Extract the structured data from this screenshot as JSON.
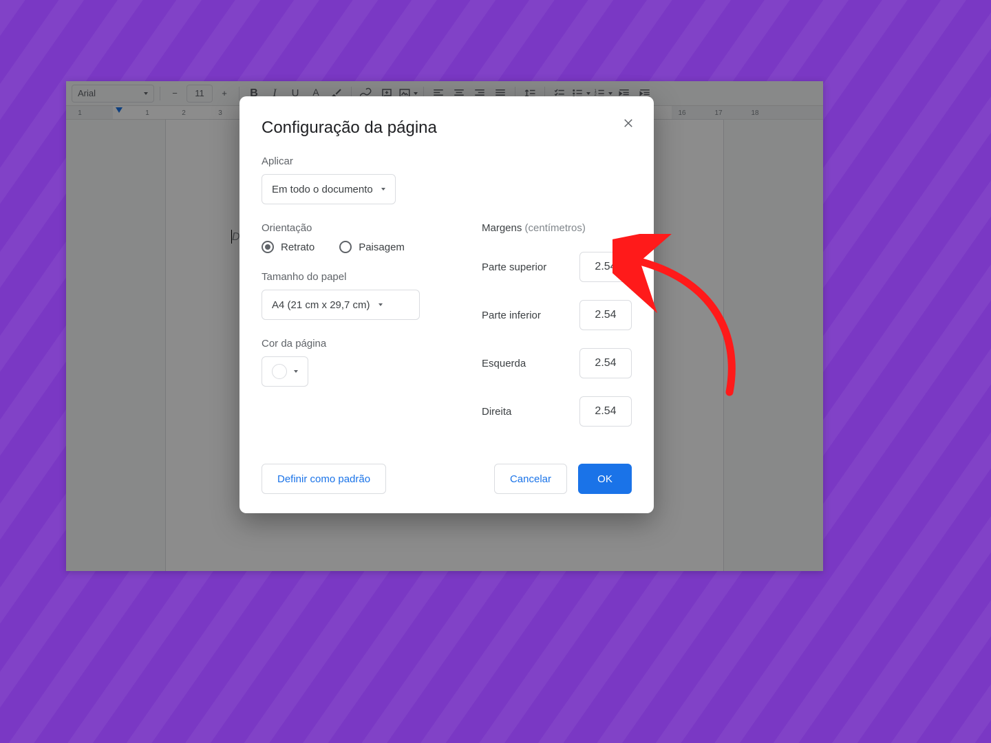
{
  "toolbar": {
    "font_name": "Arial",
    "font_size": "11"
  },
  "ruler": {
    "labels": [
      1,
      1,
      2,
      3,
      16,
      17,
      18
    ]
  },
  "document": {
    "placeholder": "Digite @ para inser"
  },
  "dialog": {
    "title": "Configuração da página",
    "apply_label": "Aplicar",
    "apply_value": "Em todo o documento",
    "orientation_label": "Orientação",
    "orientation_portrait": "Retrato",
    "orientation_landscape": "Paisagem",
    "orientation_selected": "portrait",
    "paper_label": "Tamanho do papel",
    "paper_value": "A4 (21 cm x 29,7 cm)",
    "page_color_label": "Cor da página",
    "margins_label": "Margens",
    "margins_unit": "(centímetros)",
    "margins": {
      "top_label": "Parte superior",
      "top_value": "2.54",
      "bottom_label": "Parte inferior",
      "bottom_value": "2.54",
      "left_label": "Esquerda",
      "left_value": "2.54",
      "right_label": "Direita",
      "right_value": "2.54"
    },
    "footer": {
      "set_default": "Definir como padrão",
      "cancel": "Cancelar",
      "ok": "OK"
    }
  }
}
